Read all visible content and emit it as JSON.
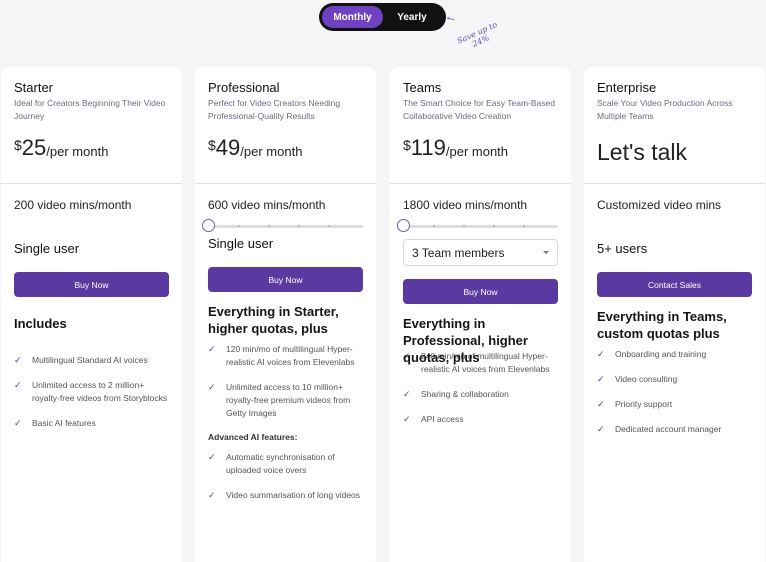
{
  "billing_toggle": {
    "options": [
      "Monthly",
      "Yearly"
    ],
    "selected": "Monthly",
    "save_note": "Save up to 24%"
  },
  "brand_color": "#5a3aa0",
  "plans": [
    {
      "name": "Starter",
      "description": "Ideal for Creators Beginning Their Video Journey",
      "currency": "$",
      "price": "25",
      "period": "/per month",
      "minutes": "200 video mins/month",
      "users": "Single user",
      "cta": "Buy Now",
      "features_title": "Includes",
      "features": [
        "Multilingual Standard AI voices",
        "Unlimited access to 2 million+ royalty-free videos from Storyblocks",
        "Basic AI features"
      ]
    },
    {
      "name": "Professional",
      "description": "Perfect for Video Creators Needing Professional-Quality Results",
      "currency": "$",
      "price": "49",
      "period": "/per month",
      "minutes": "600 video mins/month",
      "slider_value": 0,
      "users": "Single user",
      "cta": "Buy Now",
      "features_title": "Everything in Starter, higher quotas, plus",
      "features": [
        "120 min/mo of multilingual Hyper-realistic AI voices from Elevenlabs",
        "Unlimited access to 10 million+ royalty-free premium videos from Getty Images"
      ],
      "advanced_title": "Advanced AI features:",
      "advanced_features": [
        "Automatic synchronisation of uploaded voice overs",
        "Video summarisation of long videos"
      ]
    },
    {
      "name": "Teams",
      "description": "The Smart Choice for Easy Team-Based Collaborative Video Creation",
      "currency": "$",
      "price": "119",
      "period": "/per month",
      "minutes": "1800 video mins/month",
      "slider_value": 0,
      "team_select": "3 Team members",
      "cta": "Buy Now",
      "features_title": "Everything in Professional, higher quotas, plus",
      "features": [
        "240 min/mo of multilingual Hyper-realistic AI voices from Elevenlabs",
        "Sharing & collaboration",
        "API access"
      ]
    },
    {
      "name": "Enterprise",
      "description": "Scale Your Video Production Across Multiple Teams",
      "price_text": "Let's talk",
      "minutes": "Customized video mins",
      "users": "5+ users",
      "cta": "Contact Sales",
      "features_title": "Everything in Teams, custom quotas plus",
      "features": [
        "Onboarding and training",
        "Video consulting",
        "Priority support",
        "Dedicated account manager"
      ]
    }
  ]
}
